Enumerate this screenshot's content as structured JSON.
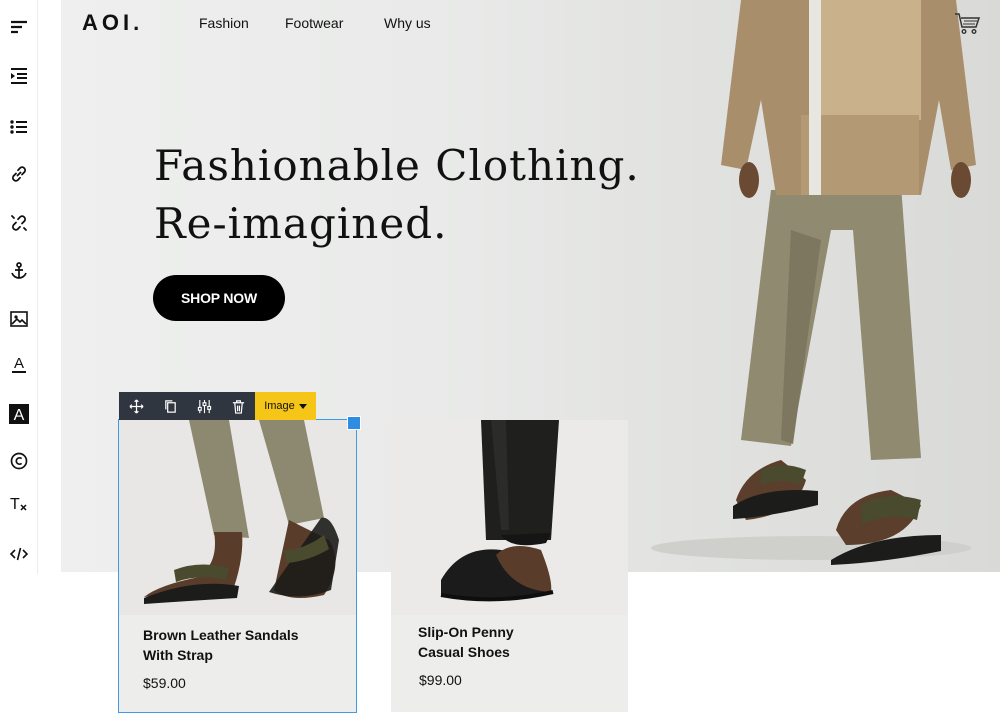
{
  "toolbar": {
    "tools": [
      {
        "name": "align-left-icon"
      },
      {
        "name": "indent-icon"
      },
      {
        "name": "bulleted-list-icon"
      },
      {
        "name": "link-icon"
      },
      {
        "name": "unlink-icon"
      },
      {
        "name": "anchor-icon"
      },
      {
        "name": "image-icon"
      },
      {
        "name": "font-color-icon",
        "glyph": "A"
      },
      {
        "name": "background-color-icon",
        "glyph": "A"
      },
      {
        "name": "copyright-icon"
      },
      {
        "name": "clear-format-icon",
        "glyph": "T"
      },
      {
        "name": "code-icon"
      }
    ]
  },
  "header": {
    "logo": "AOI.",
    "nav": [
      "Fashion",
      "Footwear",
      "Why us"
    ],
    "cart_icon": "cart-icon"
  },
  "hero": {
    "headline_line1": "Fashionable Clothing.",
    "headline_line2": "Re-imagined.",
    "cta_label": "SHOP NOW"
  },
  "element_toolbar": {
    "tools": [
      "move-icon",
      "duplicate-icon",
      "settings-icon",
      "delete-icon"
    ],
    "tag_label": "Image"
  },
  "products": [
    {
      "name_line1": "Brown Leather Sandals",
      "name_line2": "With Strap",
      "price": "$59.00"
    },
    {
      "name_line1": "Slip-On Penny",
      "name_line2": "Casual Shoes",
      "price": "$99.00"
    }
  ],
  "colors": {
    "selection": "#3d9be9",
    "tag_yellow": "#f5c518",
    "toolbar_dark": "#2f3640",
    "cta_bg": "#000000"
  }
}
